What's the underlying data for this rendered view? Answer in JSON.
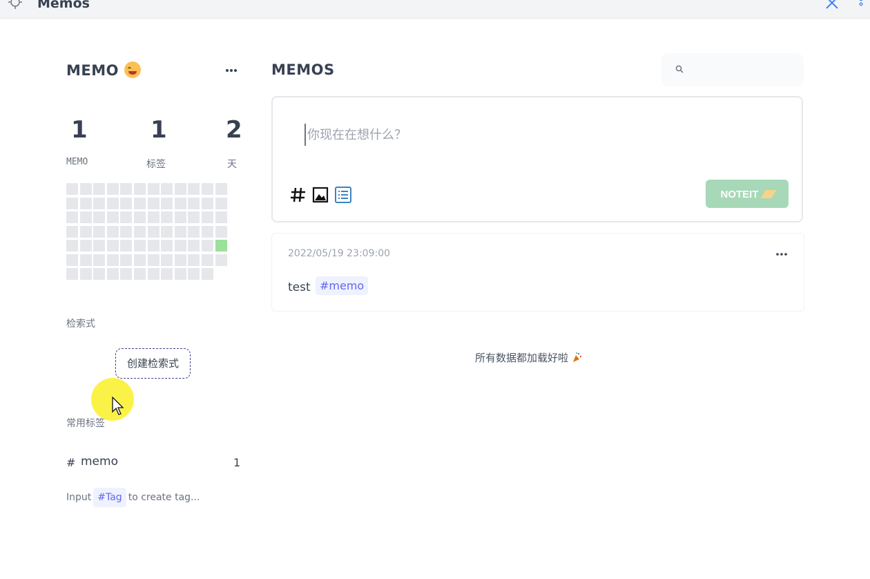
{
  "window": {
    "title": "Memos"
  },
  "sidebar": {
    "user_name": "MEMO",
    "stats": [
      {
        "value": "1",
        "label": "MEMO"
      },
      {
        "value": "1",
        "label": "标签"
      },
      {
        "value": "2",
        "label": "天"
      }
    ],
    "query_section_title": "检索式",
    "create_query_label": "创建检索式",
    "tags_section_title": "常用标签",
    "tags": [
      {
        "hash": "#",
        "name": "memo",
        "count": "1"
      }
    ],
    "tag_tip": {
      "prefix": "Input",
      "tag": "#Tag",
      "suffix": "to create tag..."
    }
  },
  "main": {
    "title": "MEMOS",
    "search": {
      "placeholder": "",
      "value": ""
    },
    "editor": {
      "placeholder": "你现在在想什么？",
      "submit_label": "NOTEIT"
    },
    "memos": [
      {
        "time": "2022/05/19 23:09:00",
        "text": "test",
        "tag": "#memo"
      }
    ],
    "loaded_text": "所有数据都加载好啦"
  },
  "colors": {
    "accent_green": "#a7d8b7",
    "tag_blue": "#6366f1",
    "heatmap_empty": "#e5e7eb",
    "heatmap_active": "#9be09b"
  },
  "heatmap": {
    "active_days": 1
  }
}
